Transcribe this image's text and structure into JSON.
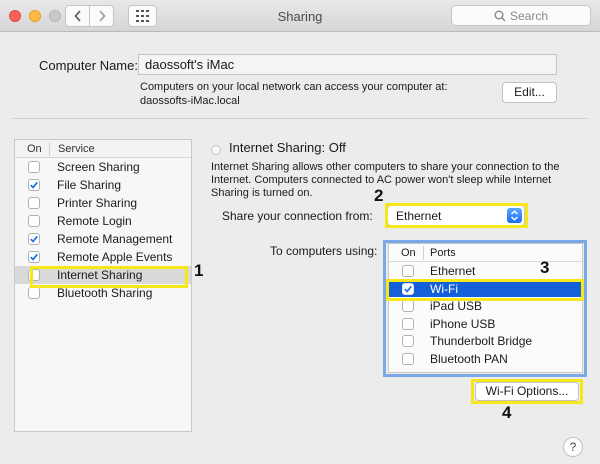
{
  "window": {
    "title": "Sharing",
    "search_placeholder": "Search"
  },
  "computer_name": {
    "label": "Computer Name:",
    "value": "daossoft's iMac",
    "info_line1": "Computers on your local network can access your computer at:",
    "info_line2": "daossofts-iMac.local",
    "edit_label": "Edit..."
  },
  "services": {
    "col_on": "On",
    "col_service": "Service",
    "items": [
      {
        "label": "Screen Sharing",
        "checked": false
      },
      {
        "label": "File Sharing",
        "checked": true
      },
      {
        "label": "Printer Sharing",
        "checked": false
      },
      {
        "label": "Remote Login",
        "checked": false
      },
      {
        "label": "Remote Management",
        "checked": true
      },
      {
        "label": "Remote Apple Events",
        "checked": true
      },
      {
        "label": "Internet Sharing",
        "checked": false,
        "selected": true
      },
      {
        "label": "Bluetooth Sharing",
        "checked": false
      }
    ]
  },
  "internet_sharing": {
    "status_title": "Internet Sharing: Off",
    "description": "Internet Sharing allows other computers to share your connection to the Internet. Computers connected to AC power won't sleep while Internet Sharing is turned on.",
    "share_from_label": "Share your connection from:",
    "share_from_value": "Ethernet",
    "to_computers_label": "To computers using:",
    "ports_col_on": "On",
    "ports_col_ports": "Ports",
    "ports": [
      {
        "label": "Ethernet",
        "checked": false
      },
      {
        "label": "Wi-Fi",
        "checked": true,
        "selected": true
      },
      {
        "label": "iPad USB",
        "checked": false
      },
      {
        "label": "iPhone USB",
        "checked": false
      },
      {
        "label": "Thunderbolt Bridge",
        "checked": false
      },
      {
        "label": "Bluetooth PAN",
        "checked": false
      }
    ],
    "wifi_options_label": "Wi-Fi Options...",
    "help_label": "?"
  },
  "annotations": {
    "badge_1": "1",
    "badge_2": "2",
    "badge_3": "3",
    "badge_4": "4",
    "highlight_color": "#f6e71a"
  },
  "colors": {
    "selection_blue": "#1460d8",
    "checkbox_blue": "#1a6ff4",
    "traffic_close": "#fc605b",
    "traffic_minimize": "#fdbc40"
  },
  "icons": {
    "back": "chevron-left-icon",
    "forward": "chevron-right-icon",
    "grid": "grid-icon",
    "search": "magnifier-icon",
    "select_arrows": "updown-arrows-icon",
    "check": "checkmark-icon"
  }
}
